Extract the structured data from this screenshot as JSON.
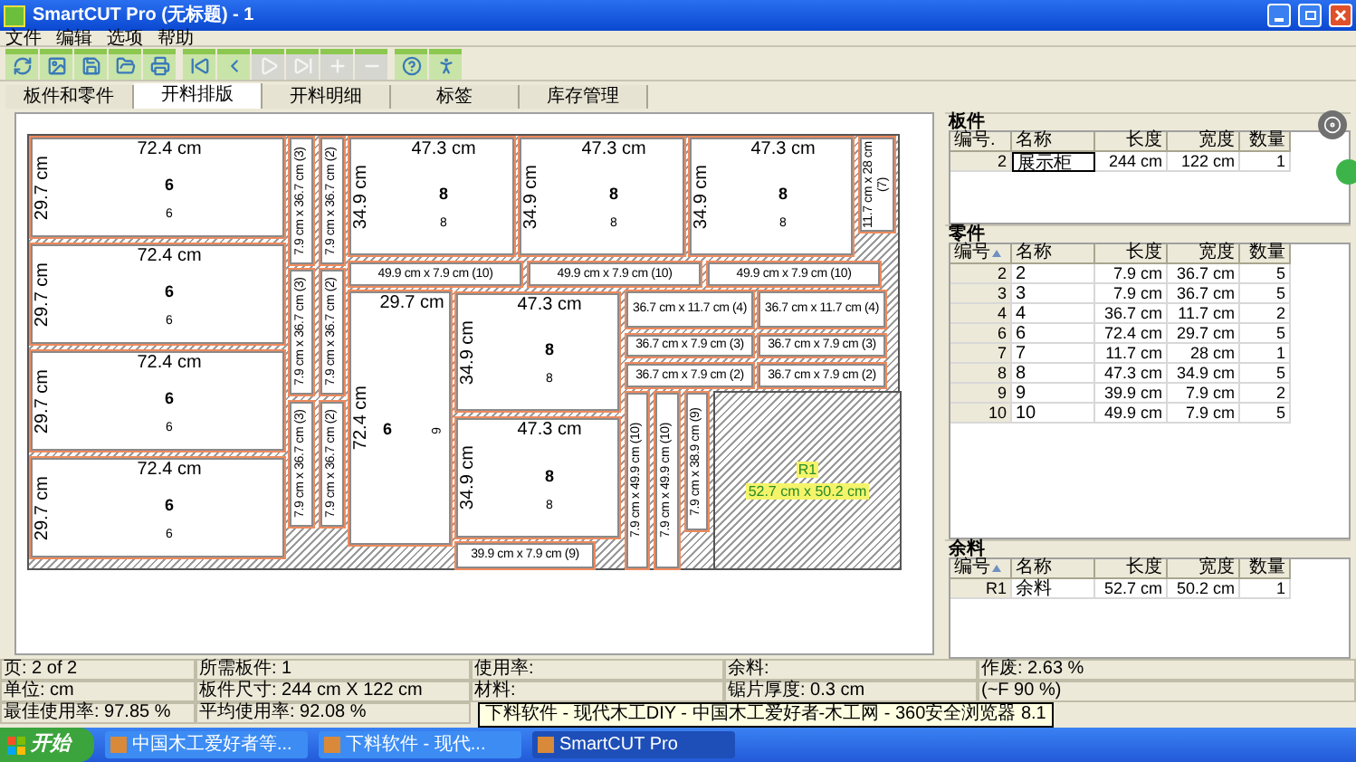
{
  "window": {
    "title": "SmartCUT Pro (无标题) - 1"
  },
  "menu": [
    "文件",
    "编辑",
    "选项",
    "帮助"
  ],
  "toolbar": [
    {
      "disabled": false
    },
    {
      "disabled": false
    },
    {
      "disabled": false
    },
    {
      "disabled": false
    },
    {
      "disabled": false
    },
    {
      "disabled": false
    },
    {
      "disabled": false
    },
    {
      "disabled": true
    },
    {
      "disabled": true
    },
    {
      "disabled": true
    },
    {
      "disabled": true
    },
    {
      "disabled": false
    },
    {
      "disabled": false
    }
  ],
  "tabs": [
    {
      "label": "板件和零件",
      "selected": false
    },
    {
      "label": "开料排版",
      "selected": true
    },
    {
      "label": "开料明细",
      "selected": false
    },
    {
      "label": "标签",
      "selected": false
    },
    {
      "label": "库存管理",
      "selected": false
    }
  ],
  "sheet": {
    "pieces": [
      {
        "kind": "large",
        "width": "72.4 cm",
        "height": "29.7 cm",
        "number": "6",
        "label": "6",
        "label_rotated": false
      },
      {
        "kind": "large",
        "width": "72.4 cm",
        "height": "29.7 cm",
        "number": "6",
        "label": "6",
        "label_rotated": false
      },
      {
        "kind": "large",
        "width": "72.4 cm",
        "height": "29.7 cm",
        "number": "6",
        "label": "6",
        "label_rotated": false
      },
      {
        "kind": "large",
        "width": "72.4 cm",
        "height": "29.7 cm",
        "number": "6",
        "label": "6",
        "label_rotated": false
      },
      {
        "kind": "strip",
        "text": "7.9 cm x 36.7 cm (3)",
        "vertical": true
      },
      {
        "kind": "strip",
        "text": "7.9 cm x 36.7 cm (2)",
        "vertical": true
      },
      {
        "kind": "strip",
        "text": "7.9 cm x 36.7 cm (3)",
        "vertical": true
      },
      {
        "kind": "strip",
        "text": "7.9 cm x 36.7 cm (2)",
        "vertical": true
      },
      {
        "kind": "strip",
        "text": "7.9 cm x 36.7 cm (3)",
        "vertical": true
      },
      {
        "kind": "strip",
        "text": "7.9 cm x 36.7 cm (2)",
        "vertical": true
      },
      {
        "kind": "large",
        "width": "47.3 cm",
        "height": "34.9 cm",
        "number": "8",
        "label": "8",
        "label_rotated": false
      },
      {
        "kind": "large",
        "width": "47.3 cm",
        "height": "34.9 cm",
        "number": "8",
        "label": "8",
        "label_rotated": false
      },
      {
        "kind": "large",
        "width": "47.3 cm",
        "height": "34.9 cm",
        "number": "8",
        "label": "8",
        "label_rotated": false
      },
      {
        "kind": "strip",
        "text": "11.7 cm x 28 cm (7)",
        "vertical": true
      },
      {
        "kind": "strip",
        "text": "49.9 cm x 7.9 cm (10)",
        "vertical": false
      },
      {
        "kind": "strip",
        "text": "49.9 cm x 7.9 cm (10)",
        "vertical": false
      },
      {
        "kind": "strip",
        "text": "49.9 cm x 7.9 cm (10)",
        "vertical": false
      },
      {
        "kind": "large",
        "width": "29.7 cm",
        "height": "72.4 cm",
        "number": "6",
        "label": "6",
        "label_rotated": true
      },
      {
        "kind": "large",
        "width": "47.3 cm",
        "height": "34.9 cm",
        "number": "8",
        "label": "8",
        "label_rotated": false
      },
      {
        "kind": "large",
        "width": "47.3 cm",
        "height": "34.9 cm",
        "number": "8",
        "label": "8",
        "label_rotated": false
      },
      {
        "kind": "strip",
        "text": "39.9 cm x 7.9 cm (9)",
        "vertical": false
      },
      {
        "kind": "strip",
        "text": "36.7 cm x 11.7 cm (4)",
        "vertical": false
      },
      {
        "kind": "strip",
        "text": "36.7 cm x 11.7 cm (4)",
        "vertical": false
      },
      {
        "kind": "strip",
        "text": "36.7 cm x 7.9 cm (3)",
        "vertical": false
      },
      {
        "kind": "strip",
        "text": "36.7 cm x 7.9 cm (3)",
        "vertical": false
      },
      {
        "kind": "strip",
        "text": "36.7 cm x 7.9 cm (2)",
        "vertical": false
      },
      {
        "kind": "strip",
        "text": "36.7 cm x 7.9 cm (2)",
        "vertical": false
      },
      {
        "kind": "strip",
        "text": "7.9 cm x 49.9 cm (10)",
        "vertical": true
      },
      {
        "kind": "strip",
        "text": "7.9 cm x 49.9 cm (10)",
        "vertical": true
      },
      {
        "kind": "strip",
        "text": "7.9 cm x 38.9 cm (9)",
        "vertical": true
      },
      {
        "kind": "offcut",
        "name": "R1",
        "size": "52.7 cm x 50.2 cm"
      }
    ]
  },
  "panels": [
    {
      "title": "板件",
      "columns": [
        {
          "label": "编号.",
          "sorted": false
        },
        {
          "label": "名称",
          "sorted": false
        },
        {
          "label": "长度",
          "sorted": false
        },
        {
          "label": "宽度",
          "sorted": false
        },
        {
          "label": "数量",
          "sorted": false
        }
      ],
      "rows": [
        [
          "2",
          "展示柜",
          "244 cm",
          "122 cm",
          "1"
        ]
      ]
    },
    {
      "title": "零件",
      "columns": [
        {
          "label": "编号",
          "sorted": true
        },
        {
          "label": "名称",
          "sorted": false
        },
        {
          "label": "长度",
          "sorted": false
        },
        {
          "label": "宽度",
          "sorted": false
        },
        {
          "label": "数量",
          "sorted": false
        }
      ],
      "rows": [
        [
          "2",
          "2",
          "7.9 cm",
          "36.7 cm",
          "5"
        ],
        [
          "3",
          "3",
          "7.9 cm",
          "36.7 cm",
          "5"
        ],
        [
          "4",
          "4",
          "36.7 cm",
          "11.7 cm",
          "2"
        ],
        [
          "6",
          "6",
          "72.4 cm",
          "29.7 cm",
          "5"
        ],
        [
          "7",
          "7",
          "11.7 cm",
          "28 cm",
          "1"
        ],
        [
          "8",
          "8",
          "47.3 cm",
          "34.9 cm",
          "5"
        ],
        [
          "9",
          "9",
          "39.9 cm",
          "7.9 cm",
          "2"
        ],
        [
          "10",
          "10",
          "49.9 cm",
          "7.9 cm",
          "5"
        ]
      ]
    },
    {
      "title": "余料",
      "columns": [
        {
          "label": "编号",
          "sorted": true
        },
        {
          "label": "名称",
          "sorted": false
        },
        {
          "label": "长度",
          "sorted": false
        },
        {
          "label": "宽度",
          "sorted": false
        },
        {
          "label": "数量",
          "sorted": false
        }
      ],
      "rows": [
        [
          "R1",
          "余料",
          "52.7 cm",
          "50.2 cm",
          "1"
        ]
      ]
    }
  ],
  "status_bar": [
    [
      "页: 2 of 2",
      "所需板件: 1",
      "使用率:",
      "余料:",
      "作废: 2.63 %"
    ],
    [
      "单位: cm",
      "板件尺寸: 244 cm X 122 cm",
      "材料:",
      "锯片厚度: 0.3 cm",
      "(~F 90 %)"
    ],
    [
      "最佳使用率: 97.85 %",
      "平均使用率: 92.08 %"
    ]
  ],
  "tooltip": "下料软件 - 现代木工DIY - 中国木工爱好者-木工网 - 360安全浏览器 8.1",
  "taskbar": {
    "start": "开始",
    "items": [
      {
        "label": "中国木工爱好者等...",
        "selected": false
      },
      {
        "label": "下料软件 - 现代...",
        "selected": false
      },
      {
        "label": "SmartCUT Pro",
        "selected": true
      }
    ]
  }
}
